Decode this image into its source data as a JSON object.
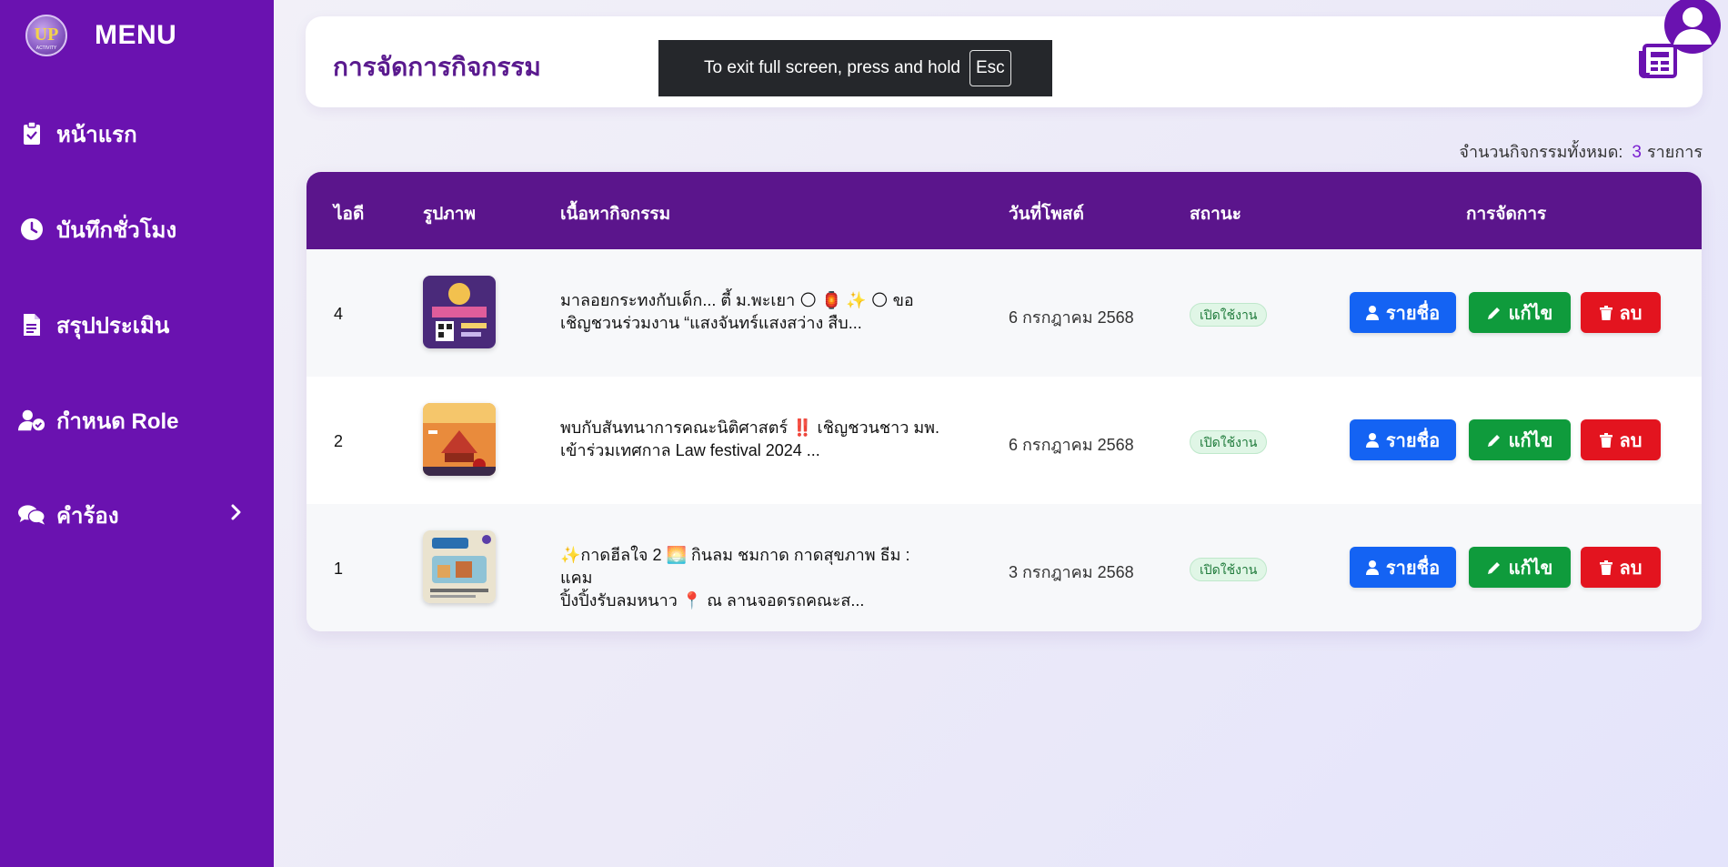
{
  "sidebar": {
    "title": "MENU",
    "logo_text": "UP ACTIVITY",
    "items": [
      {
        "label": "หน้าแรก",
        "icon": "clipboard-icon"
      },
      {
        "label": "บันทึกชั่วโมง",
        "icon": "clock-icon"
      },
      {
        "label": "สรุปประเมิน",
        "icon": "document-icon"
      },
      {
        "label": "กำหนด Role",
        "icon": "user-check-icon"
      },
      {
        "label": "คำร้อง",
        "icon": "chat-icon"
      }
    ]
  },
  "header": {
    "title": "การจัดการกิจกรรม",
    "icon": "newspaper-icon"
  },
  "fullscreen_toast": {
    "text": "To exit full screen, press and hold",
    "key": "Esc"
  },
  "count": {
    "label": "จำนวนกิจกรรมทั้งหมด:",
    "value": "3",
    "unit": "รายการ"
  },
  "table": {
    "headers": {
      "id": "ไอดี",
      "image": "รูปภาพ",
      "content": "เนื้อหากิจกรรม",
      "date": "วันที่โพสต์",
      "status": "สถานะ",
      "actions": "การจัดการ"
    },
    "rows": [
      {
        "id": "4",
        "content_line1": "มาลอยกระทงกับเด็ก... ตี้ ม.พะเยา 🌕 🏮 ✨ 🌕 ขอ",
        "content_line2": "เชิญชวนร่วมงาน “แสงจันทร์แสงสว่าง สืบ...",
        "date": "6 กรกฎาคม 2568",
        "status": "เปิดใช้งาน"
      },
      {
        "id": "2",
        "content_line1": "พบกับสันทนาการคณะนิติศาสตร์ ‼️ เชิญชวนชาว มพ.",
        "content_line2": "เข้าร่วมเทศกาล Law festival 2024 ...",
        "date": "6 กรกฎาคม 2568",
        "status": "เปิดใช้งาน"
      },
      {
        "id": "1",
        "content_line1": "✨กาดฮีลใจ 2 🌅 กินลม ชมกาด กาดสุขภาพ ธีม : แคม",
        "content_line2": "ปิ้งปิ้งรับลมหนาว 📍 ณ ลานจอดรถคณะส...",
        "date": "3 กรกฎาคม 2568",
        "status": "เปิดใช้งาน"
      }
    ],
    "buttons": {
      "list": "รายชื่อ",
      "edit": "แก้ไข",
      "delete": "ลบ"
    }
  },
  "colors": {
    "sidebar": "#6a12b0",
    "table_header": "#5b158c",
    "btn_list": "#1463f3",
    "btn_edit": "#0f9b3c",
    "btn_delete": "#e3141f"
  }
}
